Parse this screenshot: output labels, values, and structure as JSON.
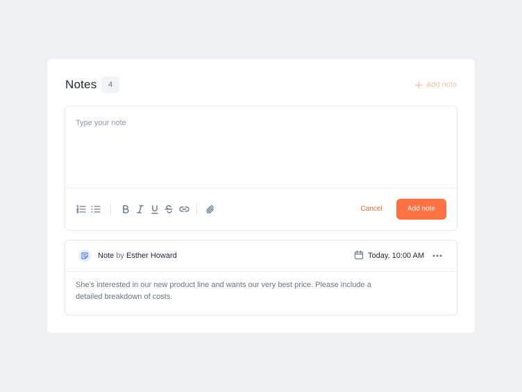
{
  "notes": {
    "title": "Notes",
    "count": "4",
    "add_link_label": "Add note"
  },
  "composer": {
    "placeholder": "Type your note",
    "value": "",
    "toolbar": [
      "ordered-list-icon",
      "bullet-list-icon",
      "bold-icon",
      "italic-icon",
      "underline-icon",
      "strikethrough-icon",
      "link-icon",
      "attachment-icon"
    ],
    "cancel_label": "Cancel",
    "submit_label": "Add note"
  },
  "note": {
    "prefix": "Note",
    "by_word": "by",
    "author": "Esther Howard",
    "timestamp": "Today, 10:00 AM",
    "body": "She's interested in our new product line and wants our very best price. Please include a detailed breakdown of costs."
  },
  "colors": {
    "accent": "#ff7043",
    "accent_light": "#f8c3a9",
    "background": "#eef0f4",
    "card": "#ffffff",
    "icon_gray": "#6b7a90",
    "note_icon_blue": "#4f7cf0"
  }
}
